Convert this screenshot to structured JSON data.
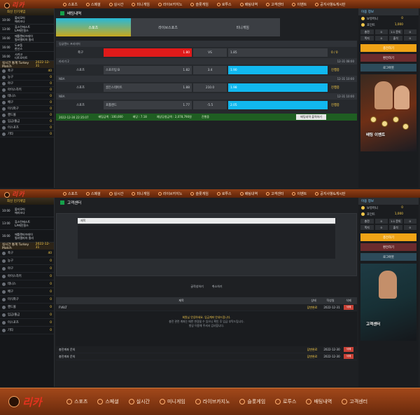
{
  "nav": [
    "스포츠",
    "스페셜",
    "실시간",
    "미니게임",
    "라이브카지노",
    "슬롯게임",
    "로투스",
    "배팅내역",
    "고객센터",
    "이벤트",
    "공지사항&게시판"
  ],
  "bottom_nav": [
    "스포츠",
    "스페셜",
    "실시간",
    "미니게임",
    "라이브카지노",
    "슬롯게임",
    "로투스",
    "배팅내역",
    "고객센터"
  ],
  "left": {
    "head": "최신 인기게임",
    "games": [
      {
        "time": "10:00",
        "a": "볼티모어",
        "b": "애리조나"
      },
      {
        "time": "13:00",
        "a": "휴스턴애스트",
        "b": "LA에인절스"
      },
      {
        "time": "16:00",
        "a": "애틀랜타브레이",
        "b": "필라델피아 필리"
      },
      {
        "time": "16:00",
        "a": "도쿄돔",
        "b": "한신스"
      },
      {
        "time": "16:00",
        "a": "시카고",
        "b": "디트로이트"
      }
    ],
    "banner_label": "실시간 통계 Turkey Match",
    "banner_date": "2022-12-31",
    "sports": [
      {
        "name": "축구",
        "count": "40"
      },
      {
        "name": "농구",
        "count": "0"
      },
      {
        "name": "야구",
        "count": "0"
      },
      {
        "name": "아이스하키",
        "count": "0"
      },
      {
        "name": "테니스",
        "count": "0"
      },
      {
        "name": "배구",
        "count": "0"
      },
      {
        "name": "미식축구",
        "count": "0"
      },
      {
        "name": "핸드볼",
        "count": "0"
      },
      {
        "name": "입금/출금",
        "count": "0"
      },
      {
        "name": "이스포츠",
        "count": "0"
      },
      {
        "name": "기타",
        "count": "0"
      }
    ]
  },
  "betting": {
    "title": "배팅내역",
    "tabs": [
      "스포츠",
      "라이브스포츠",
      "미니게임"
    ],
    "blocks": [
      {
        "league": "잉글랜드 프리미어",
        "time": "",
        "sport": "축구",
        "home": "",
        "home_odds": "1.80",
        "mid": "VS",
        "away": "",
        "away_odds": "1.85",
        "result": "0 / 0",
        "sel": "home"
      },
      {
        "league": "라리가 2",
        "time": "12-31 08:00",
        "sport": "스포츠",
        "home": "스포르팅 B",
        "home_odds": "1.82",
        "mid": "3.4",
        "away": "",
        "away_odds": "1.90",
        "result": "진행중",
        "sel": "away"
      },
      {
        "league": "NBA",
        "time": "12-31 10:00",
        "sport": "스포츠",
        "home": "골든스테이트",
        "home_odds": "1.88",
        "mid": "210.0",
        "away": "",
        "away_odds": "1.98",
        "result": "진행중",
        "sel": "away"
      },
      {
        "league": "NBA",
        "time": "12-31 10:00",
        "sport": "스포츠",
        "home": "포틀랜드",
        "home_odds": "1.77",
        "mid": "-5.5",
        "away": "",
        "away_odds": "2.05",
        "result": "진행중",
        "sel": "away"
      }
    ],
    "footer": {
      "date": "2022-12-30 22:35:07",
      "bet": "배팅금액 : 100,000",
      "odds": "배당 : 7.18",
      "win": "예상당첨금액 : 2,078,790원",
      "status": "진행중",
      "button": "배팅내역 출력하기"
    }
  },
  "right": {
    "head": "이용 정보",
    "user": "팔로워",
    "money_label": "보유머니",
    "money": "0",
    "point_label": "포인트",
    "point": "1,000",
    "grid": [
      "충전",
      "0",
      "1:1 문의",
      "0",
      "쪽지",
      "0",
      "출석",
      "0"
    ],
    "btn_charge": "충전하기",
    "btn_withdraw": "환전하기",
    "btn_logout": "로그아웃",
    "promo1": "배팅 이벤트",
    "promo2": "고객센터"
  },
  "cs": {
    "title": "고객센터",
    "input": "제목",
    "btn_submit": "글작성하기",
    "btn_cancel": "취소하기",
    "table_head": [
      "제목",
      "상태",
      "작성일",
      "삭제"
    ],
    "rows": [
      {
        "title": "FV8LT",
        "status": "답변완료",
        "date": "2022-12-31",
        "del": "삭제"
      },
      {
        "title": "충전계좌 문의",
        "status": "답변완료",
        "date": "2022-12-30",
        "del": "삭제"
      },
      {
        "title": "충전계좌 문의",
        "status": "답변완료",
        "date": "2022-12-30",
        "del": "삭제"
      }
    ],
    "answer_1": "회원님 안녕하세요. 입금계좌 안내드립니다.",
    "answer_2": "충전 관련 계좌는 매번 변경될 수 있으니 확인 후 입금 부탁드립니다.",
    "answer_3": "항상 이용해 주셔서 감사합니다."
  },
  "colors": {
    "accent": "#f0a316",
    "nav": "#923f16",
    "red": "#e01a1a",
    "cyan": "#11b8ef",
    "green": "#1f5e22"
  }
}
